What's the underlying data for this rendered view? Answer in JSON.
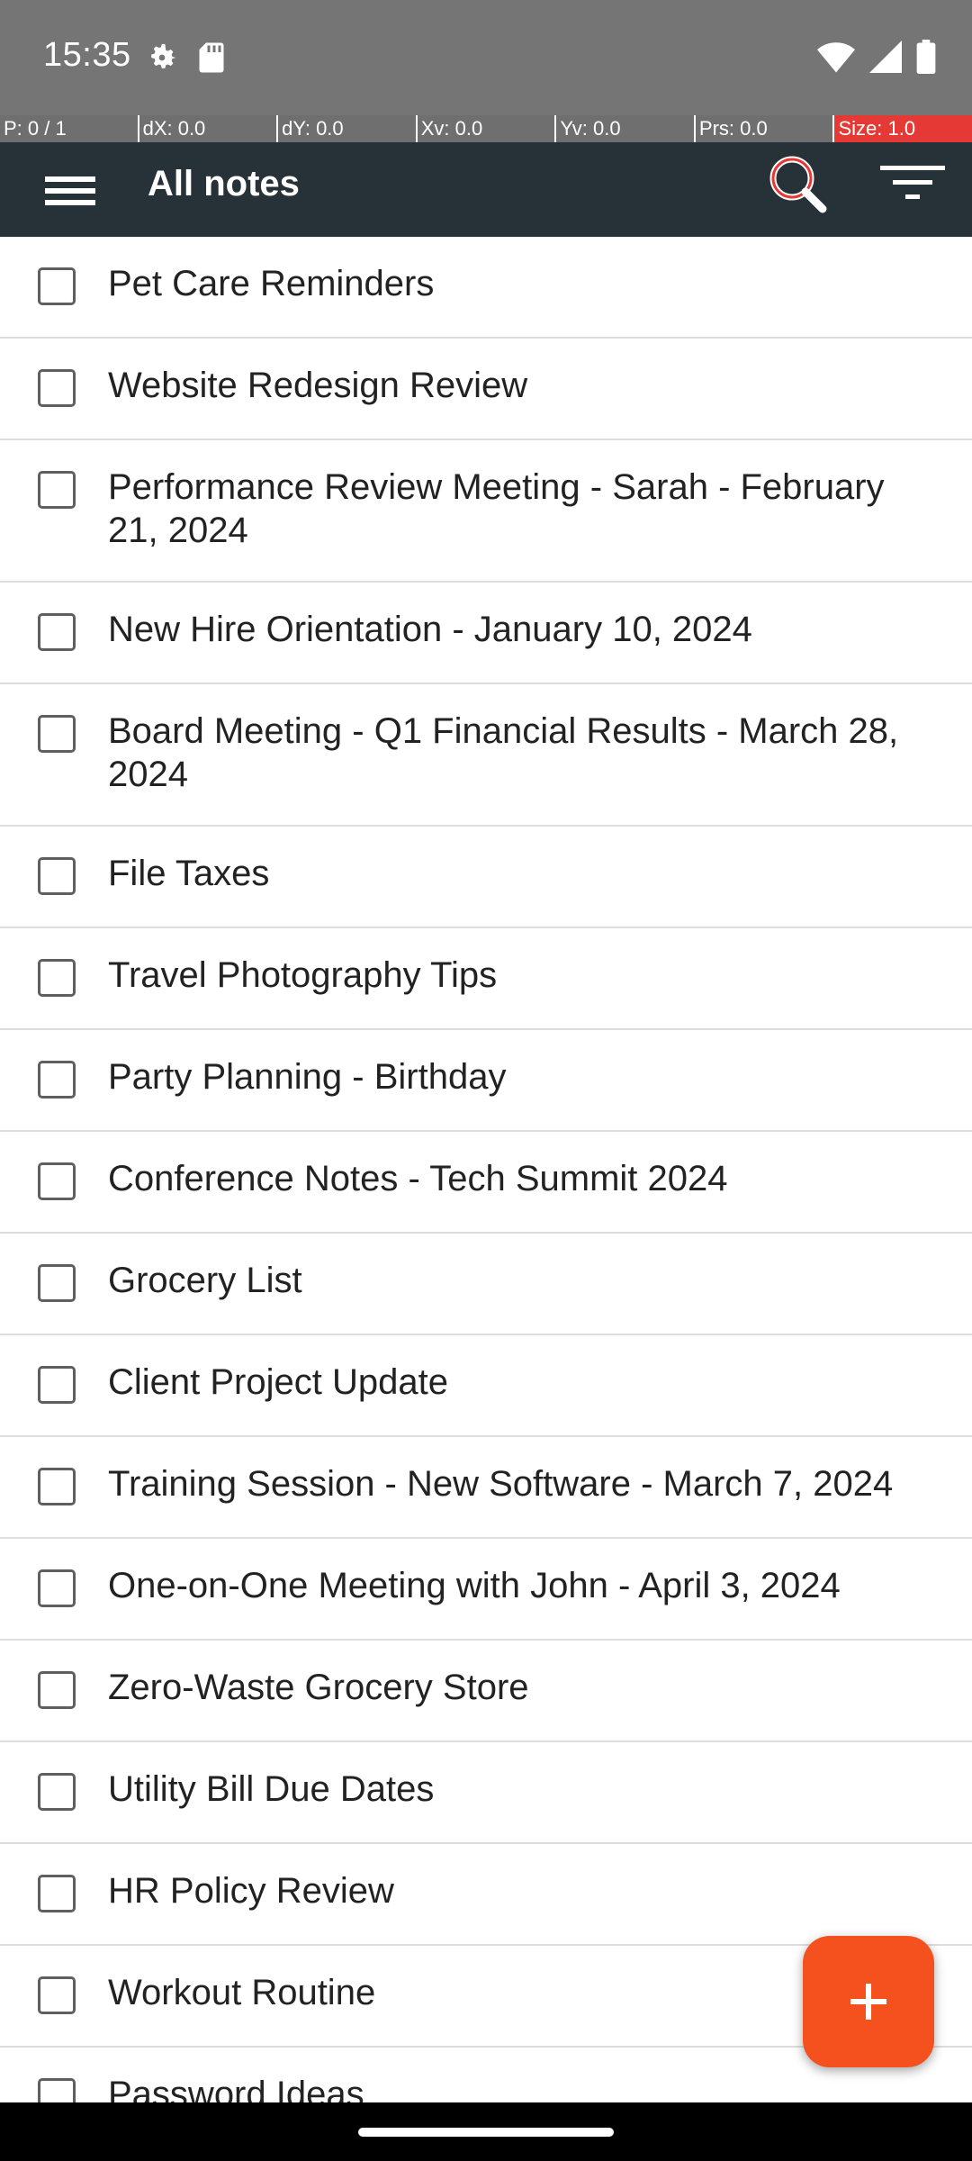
{
  "status_bar": {
    "time": "15:35",
    "left_icons": [
      "settings-icon",
      "sd-card-icon"
    ],
    "right_icons": [
      "wifi-icon",
      "signal-icon",
      "battery-icon"
    ]
  },
  "debug_overlay": {
    "cells": [
      "P: 0 / 1",
      "dX: 0.0",
      "dY: 0.0",
      "Xv: 0.0",
      "Yv: 0.0",
      "Prs: 0.0",
      "Size: 1.0"
    ]
  },
  "app_bar": {
    "title": "All notes",
    "background": "#263238",
    "icons": [
      "menu-icon",
      "search-icon",
      "filter-icon"
    ]
  },
  "notes": [
    "Pet Care Reminders",
    "Website Redesign Review",
    "Performance Review Meeting - Sarah - February 21, 2024",
    "New Hire Orientation - January 10, 2024",
    "Board Meeting - Q1 Financial Results - March 28, 2024",
    "File Taxes",
    "Travel Photography Tips",
    "Party Planning - Birthday",
    "Conference Notes - Tech Summit 2024",
    "Grocery List",
    "Client Project Update",
    "Training Session - New Software - March 7, 2024",
    "One-on-One Meeting with John - April 3, 2024",
    "Zero-Waste Grocery Store",
    "Utility Bill Due Dates",
    "HR Policy Review",
    "Workout Routine",
    "Password Ideas"
  ],
  "fab": {
    "icon": "plus-icon",
    "color": "#f4511e"
  }
}
